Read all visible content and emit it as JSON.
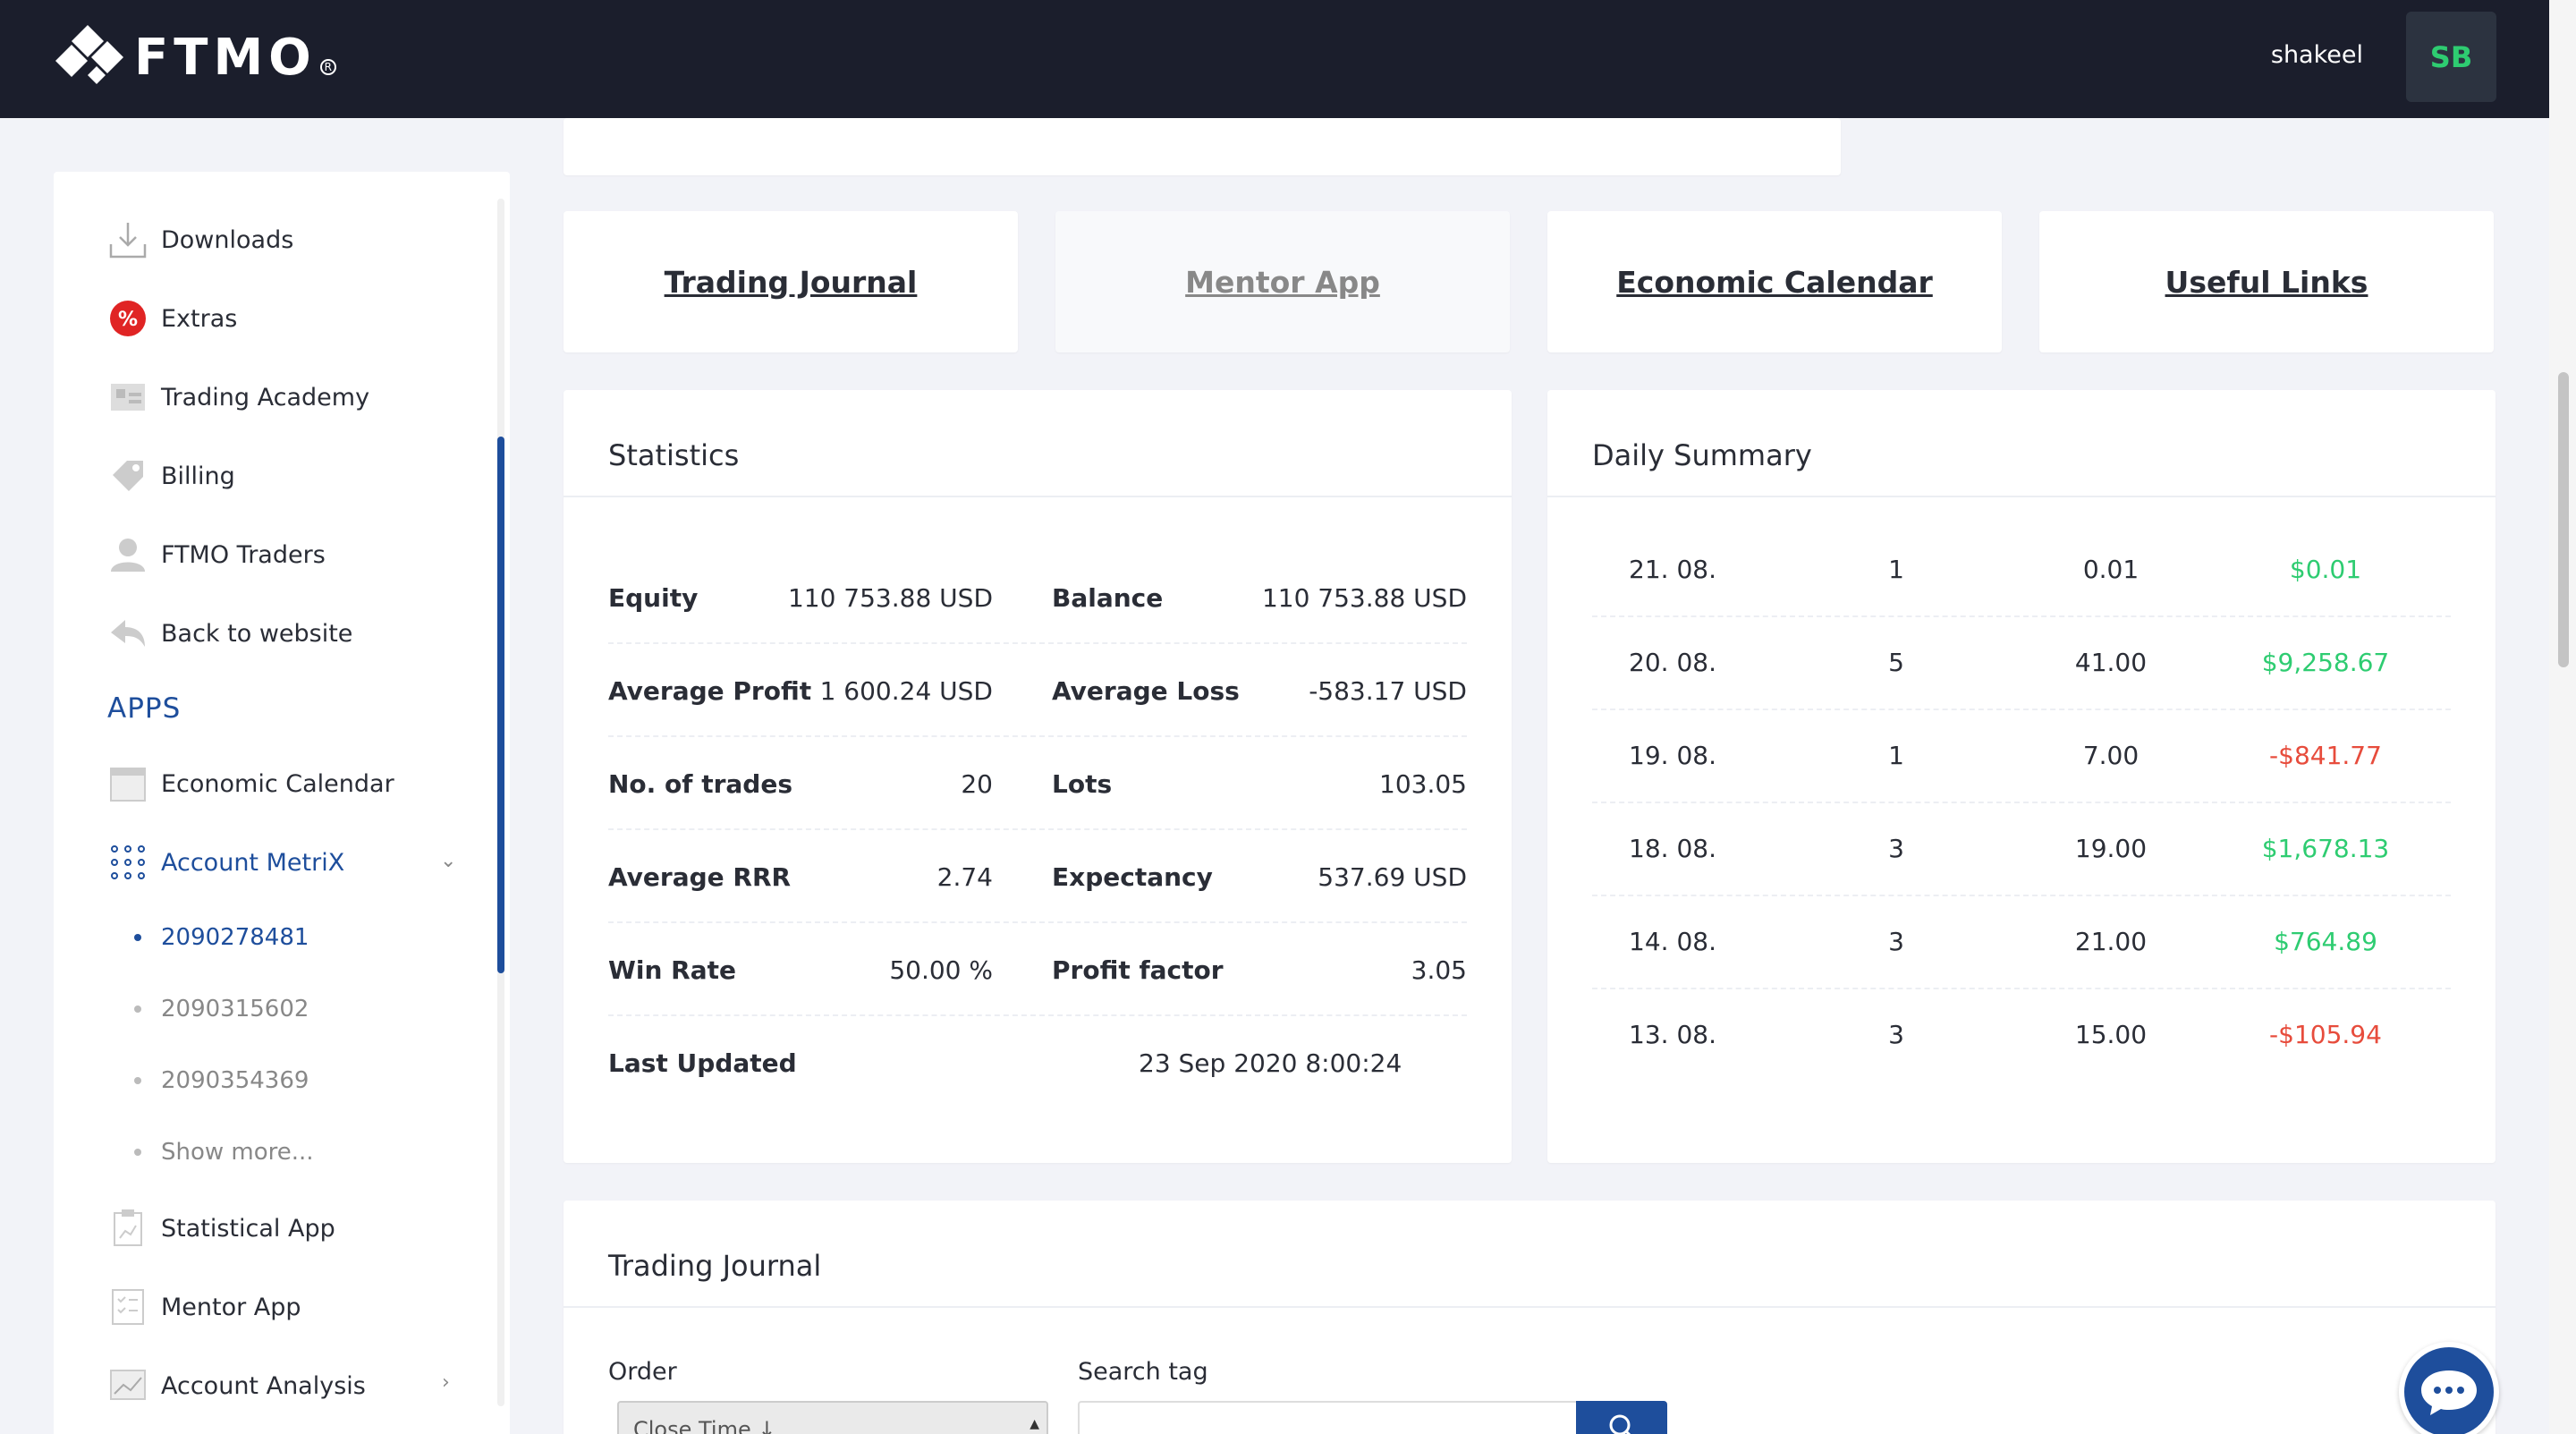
{
  "header": {
    "brand": "FTMO",
    "username": "shakeel",
    "avatar_initials": "SB"
  },
  "sidebar": {
    "items": [
      {
        "label": "Downloads",
        "icon": "download-icon"
      },
      {
        "label": "Extras",
        "icon": "percent-badge-icon"
      },
      {
        "label": "Trading Academy",
        "icon": "academy-icon"
      },
      {
        "label": "Billing",
        "icon": "billing-tag-icon"
      },
      {
        "label": "FTMO Traders",
        "icon": "traders-icon"
      },
      {
        "label": "Back to website",
        "icon": "back-arrow-icon"
      }
    ],
    "apps_heading": "APPS",
    "apps": [
      {
        "label": "Economic Calendar",
        "icon": "calendar-icon"
      },
      {
        "label": "Account MetriX",
        "icon": "grid-dots-icon"
      }
    ],
    "accounts": [
      "2090278481",
      "2090315602",
      "2090354369",
      "Show more..."
    ],
    "more_apps": [
      {
        "label": "Statistical App",
        "icon": "clipboard-chart-icon"
      },
      {
        "label": "Mentor App",
        "icon": "checklist-icon"
      },
      {
        "label": "Account Analysis",
        "icon": "analysis-chart-icon"
      }
    ]
  },
  "quick_links": [
    "Trading Journal",
    "Mentor App",
    "Economic Calendar",
    "Useful Links"
  ],
  "statistics": {
    "title": "Statistics",
    "rows": [
      {
        "l1": "Equity",
        "v1": "110 753.88 USD",
        "l2": "Balance",
        "v2": "110 753.88 USD"
      },
      {
        "l1": "Average Profit",
        "v1": "1 600.24 USD",
        "l2": "Average Loss",
        "v2": "-583.17 USD"
      },
      {
        "l1": "No. of trades",
        "v1": "20",
        "l2": "Lots",
        "v2": "103.05"
      },
      {
        "l1": "Average RRR",
        "v1": "2.74",
        "l2": "Expectancy",
        "v2": "537.69 USD"
      },
      {
        "l1": "Win Rate",
        "v1": "50.00 %",
        "l2": "Profit factor",
        "v2": "3.05"
      }
    ],
    "last_updated_label": "Last Updated",
    "last_updated_value": "23 Sep 2020 8:00:24"
  },
  "daily_summary": {
    "title": "Daily Summary",
    "rows": [
      {
        "date": "21. 08.",
        "trades": "1",
        "lots": "0.01",
        "result": "$0.01",
        "sign": "pos"
      },
      {
        "date": "20. 08.",
        "trades": "5",
        "lots": "41.00",
        "result": "$9,258.67",
        "sign": "pos"
      },
      {
        "date": "19. 08.",
        "trades": "1",
        "lots": "7.00",
        "result": "-$841.77",
        "sign": "neg"
      },
      {
        "date": "18. 08.",
        "trades": "3",
        "lots": "19.00",
        "result": "$1,678.13",
        "sign": "pos"
      },
      {
        "date": "14. 08.",
        "trades": "3",
        "lots": "21.00",
        "result": "$764.89",
        "sign": "pos"
      },
      {
        "date": "13. 08.",
        "trades": "3",
        "lots": "15.00",
        "result": "-$105.94",
        "sign": "neg"
      }
    ]
  },
  "journal": {
    "title": "Trading Journal",
    "order_label": "Order",
    "order_value": "Close Time ↓",
    "search_label": "Search tag"
  },
  "colors": {
    "topbar": "#1b1e2c",
    "accent": "#1e4e9c",
    "positive": "#2ecc71",
    "negative": "#e74c3c"
  }
}
